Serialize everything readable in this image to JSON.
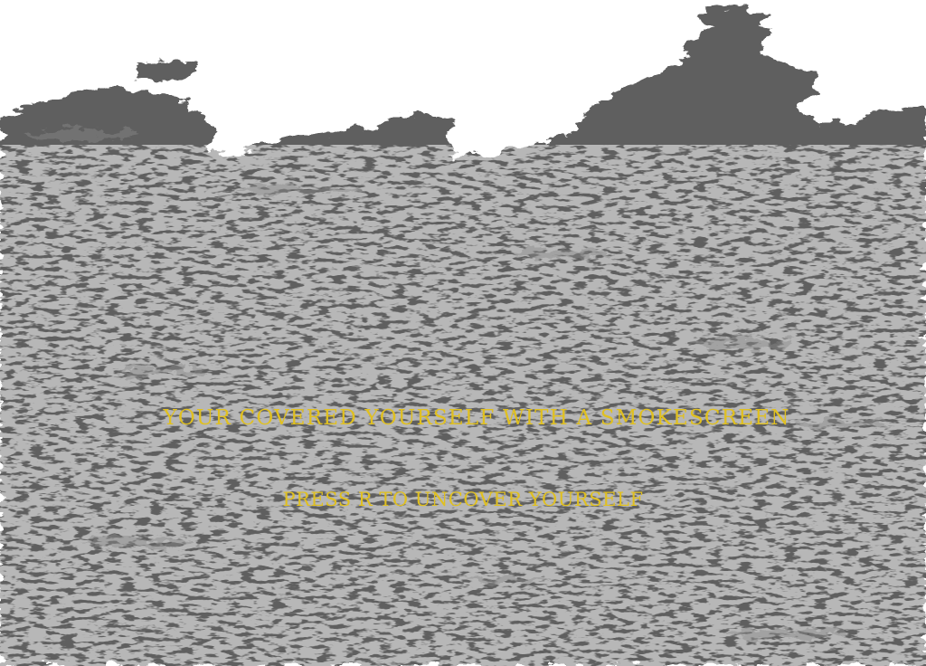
{
  "screen": {
    "background_color": "#ffffff",
    "smoke_color": "#5f5f5f",
    "text_color": "#e0c020"
  },
  "messages": {
    "main": "YOUR COVERED YOURSELF WITH A SMOKESCREEN",
    "hint": "PRESS R TO UNCOVER YOURSELF"
  },
  "controls": {
    "uncover_key": "R"
  }
}
